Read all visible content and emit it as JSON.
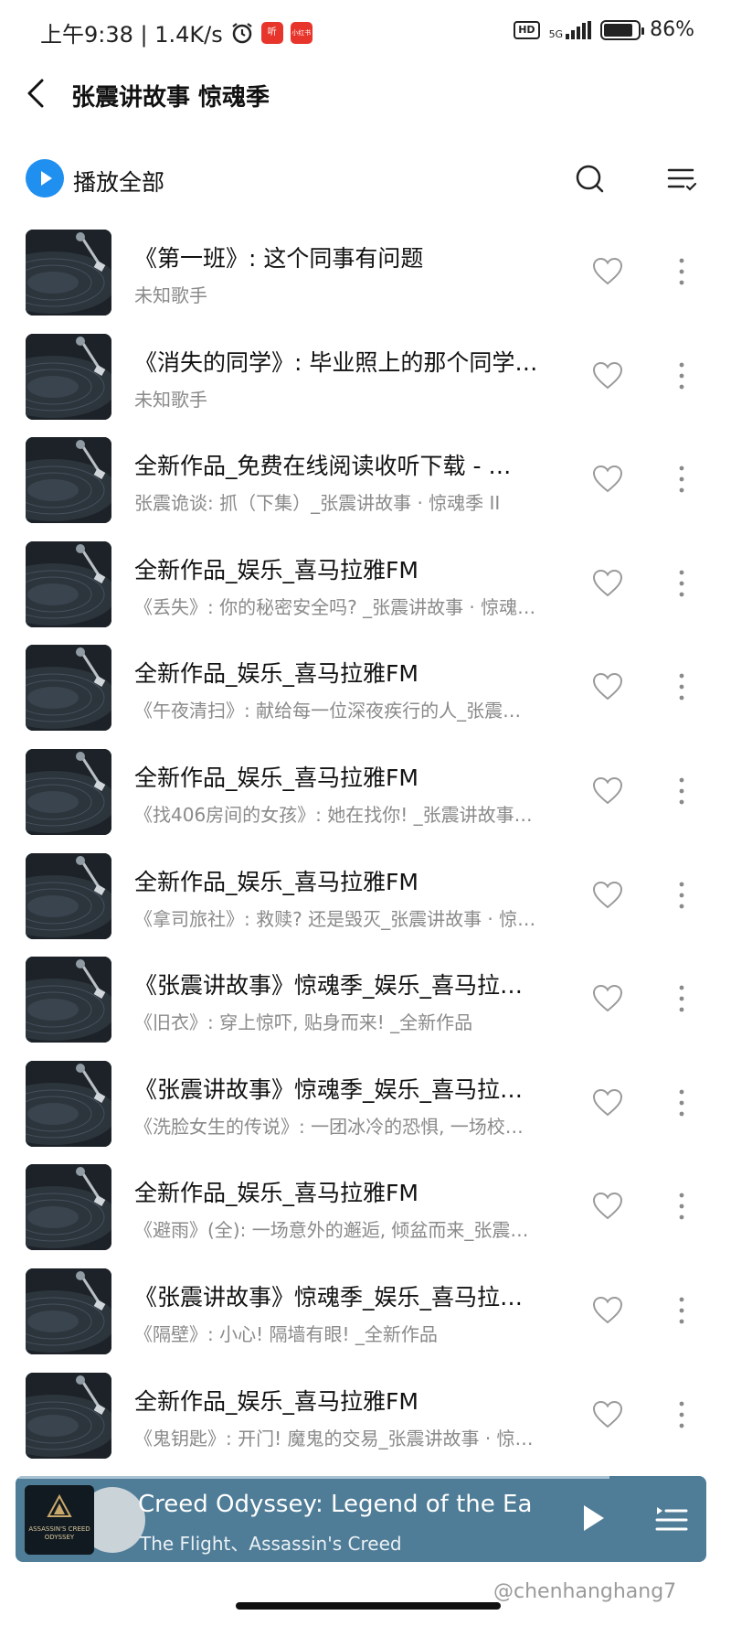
{
  "status_bar": {
    "time_speed": "上午9:38 | 1.4K/s",
    "app_badge_1": "听",
    "app_badge_2": "小红书",
    "hd": "HD",
    "network": "5G",
    "battery": "86%",
    "battery_level": 0.86
  },
  "header": {
    "title": "张震讲故事 惊魂季"
  },
  "toolbar": {
    "play_all_label": "播放全部"
  },
  "tracks": [
    {
      "title": "《第一班》: 这个同事有问题",
      "subtitle": "未知歌手"
    },
    {
      "title": "《消失的同学》: 毕业照上的那个同学…",
      "subtitle": "未知歌手"
    },
    {
      "title": "全新作品_免费在线阅读收听下载 - …",
      "subtitle": "张震诡谈: 抓（下集）_张震讲故事 · 惊魂季 II"
    },
    {
      "title": "全新作品_娱乐_喜马拉雅FM",
      "subtitle": "《丢失》: 你的秘密安全吗? _张震讲故事 · 惊魂…"
    },
    {
      "title": "全新作品_娱乐_喜马拉雅FM",
      "subtitle": "《午夜清扫》: 献给每一位深夜疾行的人_张震…"
    },
    {
      "title": "全新作品_娱乐_喜马拉雅FM",
      "subtitle": "《找406房间的女孩》: 她在找你! _张震讲故事…"
    },
    {
      "title": "全新作品_娱乐_喜马拉雅FM",
      "subtitle": "《拿司旅社》: 救赎? 还是毁灭_张震讲故事 · 惊…"
    },
    {
      "title": "《张震讲故事》惊魂季_娱乐_喜马拉…",
      "subtitle": "《旧衣》: 穿上惊吓, 贴身而来! _全新作品"
    },
    {
      "title": "《张震讲故事》惊魂季_娱乐_喜马拉…",
      "subtitle": "《洗脸女生的传说》: 一团冰冷的恐惧, 一场校…"
    },
    {
      "title": "全新作品_娱乐_喜马拉雅FM",
      "subtitle": "《避雨》(全): 一场意外的邂逅, 倾盆而来_张震…"
    },
    {
      "title": "《张震讲故事》惊魂季_娱乐_喜马拉…",
      "subtitle": "《隔壁》: 小心! 隔墙有眼! _全新作品"
    },
    {
      "title": "全新作品_娱乐_喜马拉雅FM",
      "subtitle": "《鬼钥匙》: 开门! 魔鬼的交易_张震讲故事 · 惊…"
    }
  ],
  "player": {
    "title": "Creed Odyssey: Legend of the Eagle",
    "artist": "The Flight、Assassin's Creed",
    "cover_text": "ASSASSIN'S CREED ODYSSEY",
    "progress": 0.86
  },
  "watermark": "@chenhanghang7",
  "colors": {
    "accent": "#1f8ff0",
    "player_bg": "#4f7c97",
    "subtitle": "#8a8a8a"
  }
}
